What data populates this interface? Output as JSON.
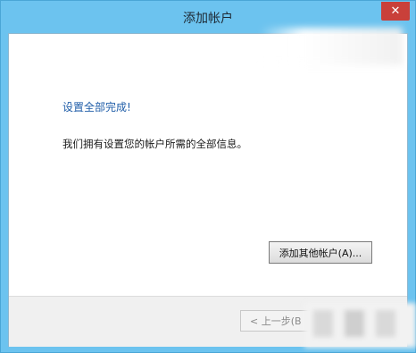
{
  "window": {
    "title": "添加帐户",
    "close_glyph": "✕"
  },
  "content": {
    "heading": "设置全部完成!",
    "description": "我们拥有设置您的帐户所需的全部信息。",
    "add_other_label": "添加其他帐户(A)..."
  },
  "footer": {
    "back_label": "< 上一步(B"
  },
  "colors": {
    "titlebar": "#6cc3ef",
    "close": "#c9403a",
    "heading": "#1f5da8"
  }
}
